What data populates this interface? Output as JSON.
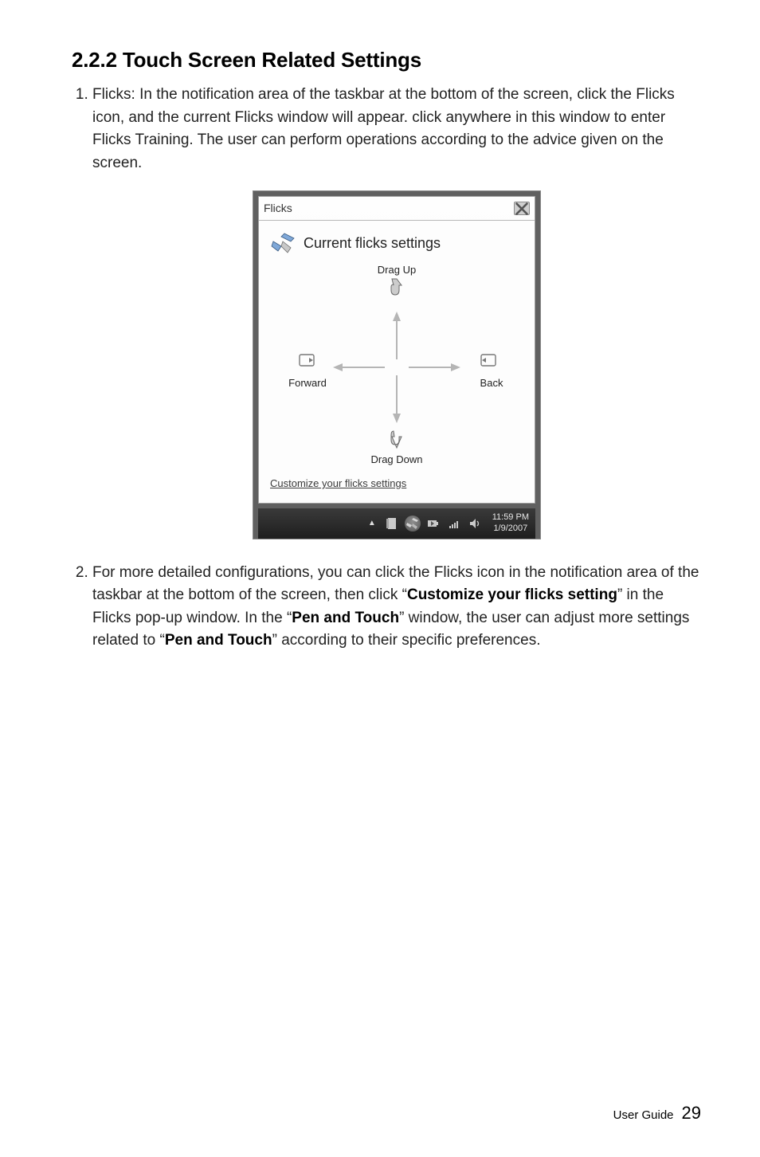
{
  "heading": "2.2.2 Touch Screen Related Settings",
  "list": {
    "item1": {
      "text_before": "Flicks: In the notification area of the taskbar at the bottom of the screen, click the Flicks icon, and the current Flicks window will appear. click anywhere in this window to enter Flicks Training. The user can perform operations according to the advice given on the screen."
    },
    "item2": {
      "seg1": "For more detailed configurations, you can click the Flicks icon in the notification area of the taskbar at the bottom of the screen, then click “",
      "bold1": "Customize your flicks setting",
      "seg2": "” in the Flicks pop-up window. In the “",
      "bold2": "Pen and Touch",
      "seg3": "” window, the user can adjust more settings related to “",
      "bold3": "Pen and Touch",
      "seg4": "” according to their specific preferences."
    }
  },
  "flicks_window": {
    "title": "Flicks",
    "header": "Current flicks settings",
    "drag_up": "Drag Up",
    "drag_down": "Drag Down",
    "forward": "Forward",
    "back": "Back",
    "customize_link": "Customize your flicks settings"
  },
  "taskbar": {
    "time": "11:59 PM",
    "date": "1/9/2007"
  },
  "footer": {
    "label": "User Guide",
    "page": "29"
  }
}
